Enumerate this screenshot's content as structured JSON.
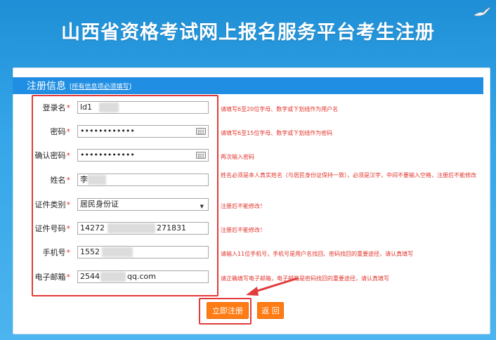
{
  "header": {
    "title": "山西省资格考试网上报名服务平台考生注册"
  },
  "section": {
    "title": "注册信息",
    "note": "[所有信息项必须填写]"
  },
  "form": {
    "required_mark": "*",
    "fields": [
      {
        "label": "登录名",
        "value": "ld1",
        "hint": "请填写6至20位字母、数字或下划线作为用户名"
      },
      {
        "label": "密码",
        "value": "••••••••••••",
        "hint": "请填写6至15位字母、数字或下划线作为密码"
      },
      {
        "label": "确认密码",
        "value": "••••••••••••",
        "hint": "再次输入密码"
      },
      {
        "label": "姓名",
        "value": "李",
        "hint": "姓名必须是本人真实姓名（与居民身份证保持一致），必须是汉字，中间不要输入空格，注册后不能修改"
      },
      {
        "label": "证件类别",
        "value": "居民身份证",
        "hint": "注册后不能修改！"
      },
      {
        "label": "证件号码",
        "value": "14272",
        "value_end": "271831",
        "hint": "注册后不能修改！"
      },
      {
        "label": "手机号",
        "value": "1552",
        "hint": "请输入11位手机号，手机号是用户名找回、密码找回的重要途径，请认真填写"
      },
      {
        "label": "电子邮箱",
        "value": "2544",
        "value_end": "qq.com",
        "hint": "请正确填写电子邮箱，电子邮箱是密码找回的重要途径，请认真填写"
      }
    ]
  },
  "buttons": {
    "register": "立即注册",
    "back": "返 回"
  },
  "colors": {
    "background": "#35a6e8",
    "header_bar": "#1f8ee3",
    "button": "#ff7c15",
    "hint": "#e0342b",
    "annotation": "#e23b3b"
  },
  "icons": [
    "keyboard-icon",
    "dropdown-arrow-icon",
    "bird-icon",
    "annotation-arrow-icon"
  ]
}
